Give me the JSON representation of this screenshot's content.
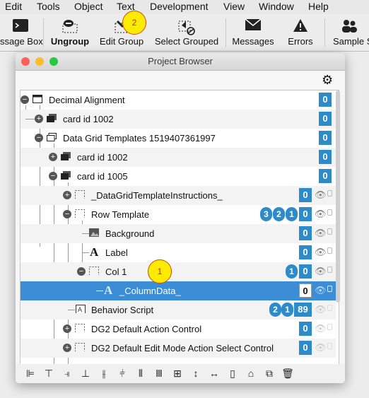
{
  "menu": {
    "items": [
      "Edit",
      "Tools",
      "Object",
      "Text",
      "Development",
      "View",
      "Window",
      "Help"
    ]
  },
  "toolbar": {
    "items": [
      {
        "label": "ssage Box",
        "icon": "terminal-icon"
      },
      {
        "label": "Ungroup",
        "icon": "ungroup-icon"
      },
      {
        "label": "Edit Group",
        "icon": "edit-group-icon"
      },
      {
        "label": "Select Grouped",
        "icon": "select-grouped-icon"
      },
      {
        "label": "Messages",
        "icon": "envelope-icon"
      },
      {
        "label": "Errors",
        "icon": "warning-icon"
      },
      {
        "label": "Sample S",
        "icon": "people-icon"
      }
    ]
  },
  "markers": {
    "one": "1",
    "two": "2"
  },
  "window": {
    "title": "Project Browser"
  },
  "tree": {
    "rows": [
      {
        "label": "Decimal Alignment",
        "count": "0"
      },
      {
        "label": "card id 1002",
        "count": "0"
      },
      {
        "label": "Data Grid Templates 1519407361997",
        "count": "0"
      },
      {
        "label": "card id 1002",
        "count": "0"
      },
      {
        "label": "card id 1005",
        "count": "0"
      },
      {
        "label": "_DataGridTemplateInstructions_",
        "count": "0"
      },
      {
        "label": "Row Template",
        "count": "0",
        "badges": [
          "3",
          "2",
          "1"
        ]
      },
      {
        "label": "Background",
        "count": "0"
      },
      {
        "label": "Label",
        "count": "0"
      },
      {
        "label": "Col 1",
        "count": "0",
        "badges": [
          "1"
        ]
      },
      {
        "label": "_ColumnData_",
        "count": "0"
      },
      {
        "label": "Behavior Script",
        "count": "89",
        "badges": [
          "2",
          "1"
        ]
      },
      {
        "label": "DG2 Default Action Control",
        "count": "0"
      },
      {
        "label": "DG2 Default Edit Mode Action Select Control",
        "count": "0"
      }
    ]
  }
}
